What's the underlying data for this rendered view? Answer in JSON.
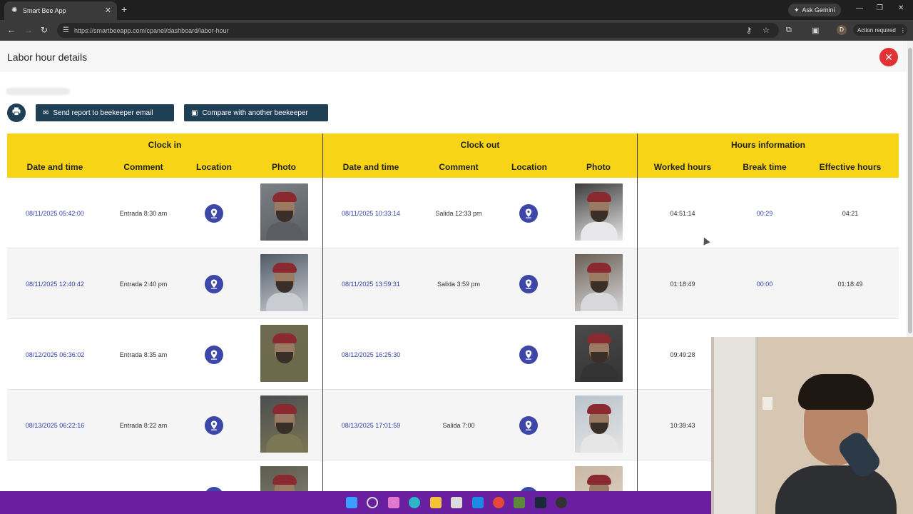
{
  "browser": {
    "tab_title": "Smart Bee App",
    "tab_close": "✕",
    "new_tab": "+",
    "gemini": "Ask Gemini",
    "url": "https://smartbeeapp.com/cpanel/dashboard/labor-hour",
    "action_required": "Action required",
    "profile_initial": "D"
  },
  "page": {
    "title": "Labor hour details",
    "send_report": "Send report to beekeeper email",
    "compare": "Compare with another beekeeper"
  },
  "table": {
    "groups": [
      "Clock in",
      "Clock out",
      "Hours information"
    ],
    "columns": [
      "Date and time",
      "Comment",
      "Location",
      "Photo",
      "Date and time",
      "Comment",
      "Location",
      "Photo",
      "Worked hours",
      "Break time",
      "Effective hours"
    ],
    "rows": [
      {
        "in_date": "08/11/2025 05:42:00",
        "in_comment": "Entrada 8:30 am",
        "out_date": "08/11/2025 10:33:14",
        "out_comment": "Salida 12:33 pm",
        "worked": "04:51:14",
        "break": "00:29",
        "effective": "04:21"
      },
      {
        "in_date": "08/11/2025 12:40:42",
        "in_comment": "Entrada 2:40 pm",
        "out_date": "08/11/2025 13:59:31",
        "out_comment": "Salida 3:59 pm",
        "worked": "01:18:49",
        "break": "00:00",
        "effective": "01:18:49"
      },
      {
        "in_date": "08/12/2025 06:36:02",
        "in_comment": "Entrada 8:35 am",
        "out_date": "08/12/2025 16:25:30",
        "out_comment": "",
        "worked": "09:49:28",
        "break": "",
        "effective": ""
      },
      {
        "in_date": "08/13/2025 06:22:16",
        "in_comment": "Entrada 8:22 am",
        "out_date": "08/13/2025 17:01:59",
        "out_comment": "Salida 7:00",
        "worked": "10:39:43",
        "break": "",
        "effective": ""
      },
      {
        "in_date": "",
        "in_comment": "",
        "out_date": "",
        "out_comment": "",
        "worked": "",
        "break": "",
        "effective": ""
      }
    ]
  },
  "colors": {
    "header_yellow": "#f7d415",
    "button_navy": "#1f3f55",
    "link_blue": "#2f3fa8",
    "pin_blue": "#3d47a8",
    "close_red": "#e03237",
    "taskbar_purple": "#6a1fa0"
  }
}
